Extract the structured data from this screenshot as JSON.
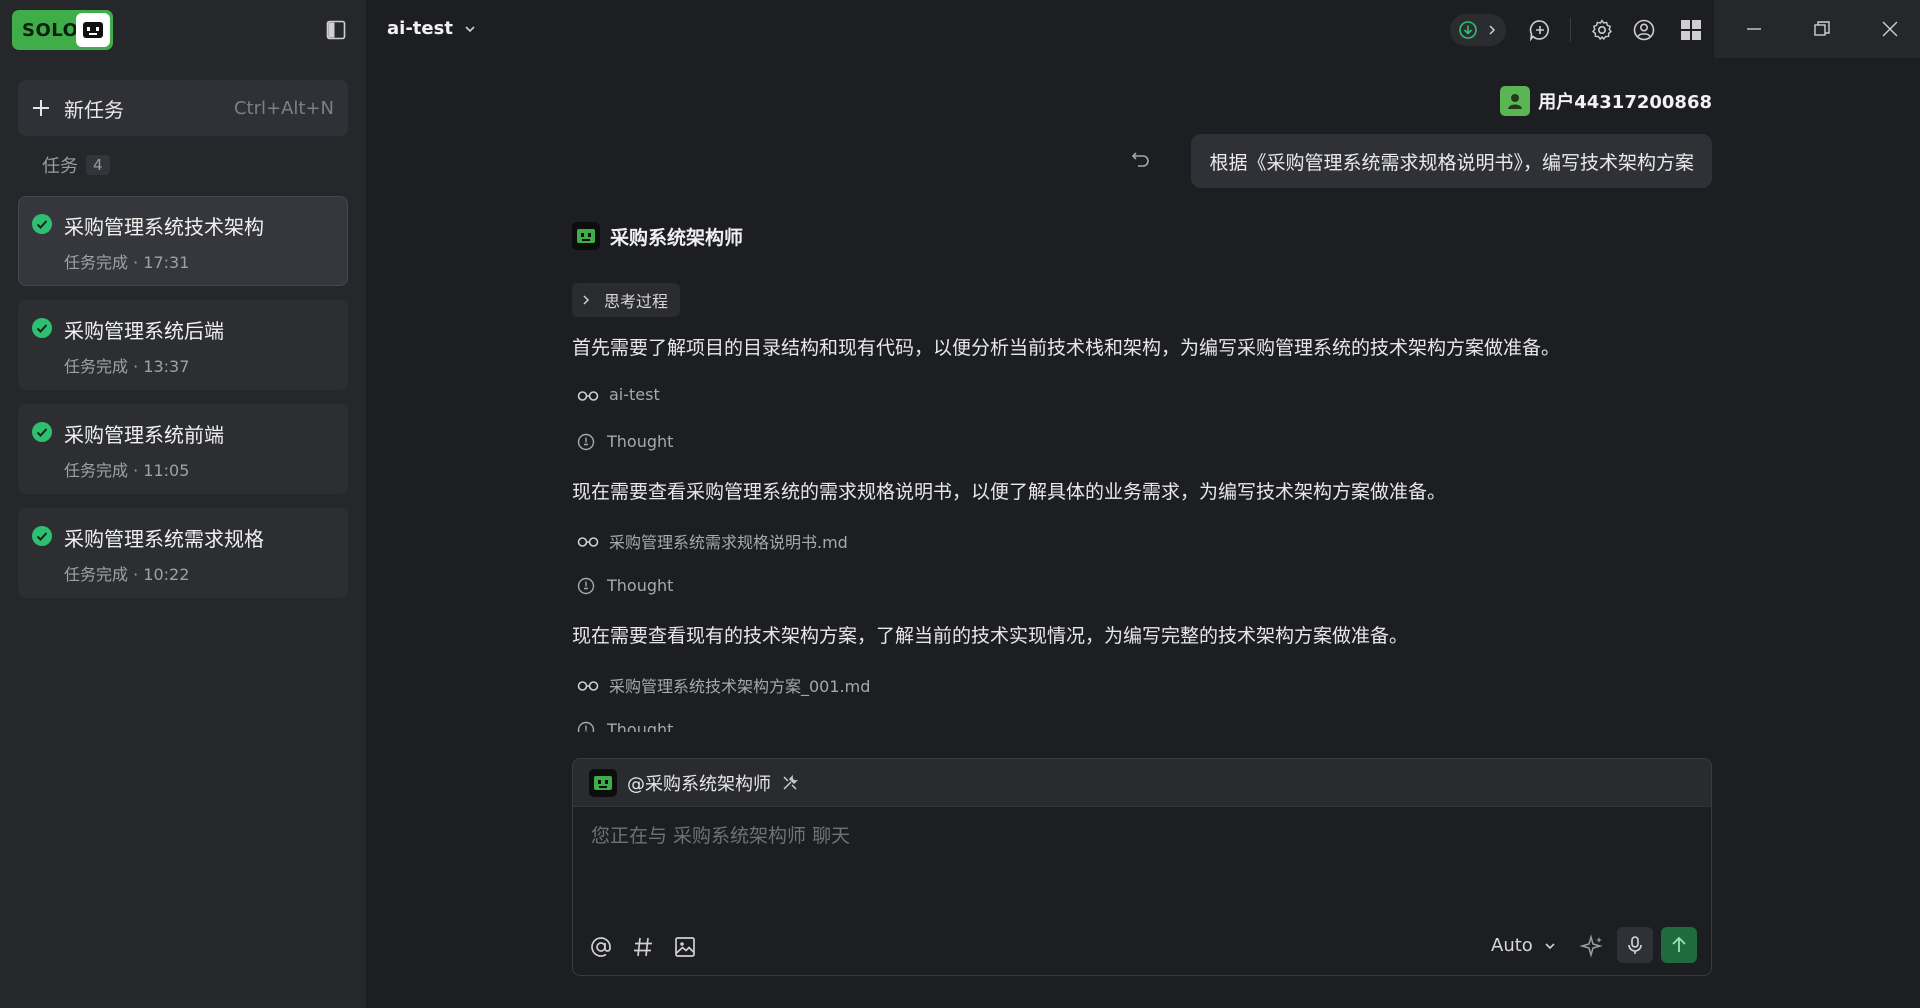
{
  "app": {
    "logo_text": "SOLO",
    "project_name": "ai-test"
  },
  "sidebar": {
    "new_task_label": "新任务",
    "new_task_shortcut": "Ctrl+Alt+N",
    "tasks_label": "任务",
    "tasks_count": "4",
    "tasks": [
      {
        "title": "采购管理系统技术架构",
        "status": "任务完成 · 17:31"
      },
      {
        "title": "采购管理系统后端",
        "status": "任务完成 · 13:37"
      },
      {
        "title": "采购管理系统前端",
        "status": "任务完成 · 11:05"
      },
      {
        "title": "采购管理系统需求规格",
        "status": "任务完成 · 10:22"
      }
    ]
  },
  "chat": {
    "user_name": "用户44317200868",
    "user_message": "根据《采购管理系统需求规格说明书》，编写技术架构方案",
    "agent_name": "采购系统架构师",
    "thinking_label": "思考过程",
    "steps": [
      {
        "text": "首先需要了解项目的目录结构和现有代码，以便分析当前技术栈和架构，为编写采购管理系统的技术架构方案做准备。"
      },
      {
        "ref": "ai-test"
      },
      {
        "thought": "Thought"
      },
      {
        "text": "现在需要查看采购管理系统的需求规格说明书，以便了解具体的业务需求，为编写技术架构方案做准备。"
      },
      {
        "ref": "采购管理系统需求规格说明书.md"
      },
      {
        "thought": "Thought"
      },
      {
        "text": "现在需要查看现有的技术架构方案，了解当前的技术实现情况，为编写完整的技术架构方案做准备。"
      },
      {
        "ref": "采购管理系统技术架构方案_001.md"
      },
      {
        "thought": "Thought"
      }
    ]
  },
  "composer": {
    "mention": "@采购系统架构师",
    "placeholder": "您正在与 采购系统架构师 聊天",
    "model": "Auto"
  },
  "colors": {
    "accent_green": "#3fae48",
    "check_green": "#2fbf71",
    "send_green": "#1f6b3d"
  }
}
